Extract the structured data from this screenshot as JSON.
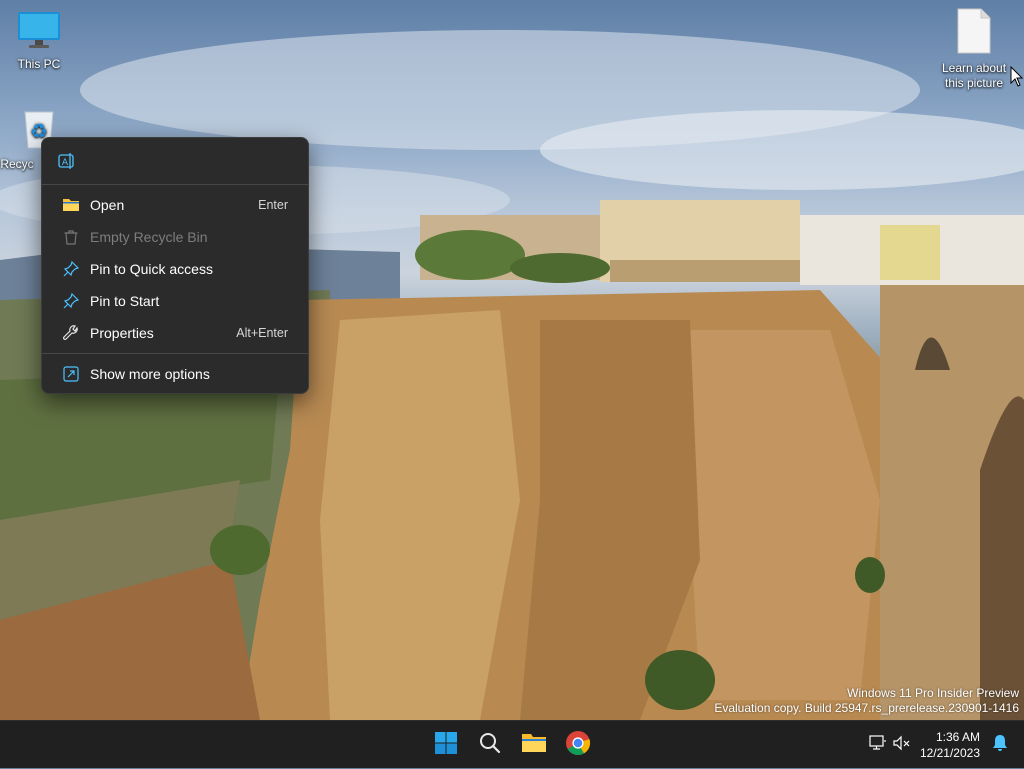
{
  "desktop": {
    "icons": [
      {
        "label": "This PC",
        "icon": "monitor-icon"
      },
      {
        "label": "Recycle Bin",
        "visible_label": "Recyc",
        "icon": "recycle-bin-icon"
      },
      {
        "label_line1": "Learn about",
        "label_line2": "this picture",
        "icon": "document-icon"
      }
    ]
  },
  "context_menu": {
    "top_action_icon": "rename-icon",
    "items": [
      {
        "label": "Open",
        "shortcut": "Enter",
        "icon": "folder-icon",
        "enabled": true
      },
      {
        "label": "Empty Recycle Bin",
        "shortcut": "",
        "icon": "trash-icon",
        "enabled": false
      },
      {
        "label": "Pin to Quick access",
        "shortcut": "",
        "icon": "pin-icon",
        "enabled": true
      },
      {
        "label": "Pin to Start",
        "shortcut": "",
        "icon": "pin-icon",
        "enabled": true
      },
      {
        "label": "Properties",
        "shortcut": "Alt+Enter",
        "icon": "wrench-icon",
        "enabled": true
      },
      {
        "label": "Show more options",
        "shortcut": "",
        "icon": "more-options-icon",
        "enabled": true
      }
    ]
  },
  "watermark": {
    "line1": "Windows 11 Pro Insider Preview",
    "line2": "Evaluation copy. Build 25947.rs_prerelease.230901-1416"
  },
  "taskbar": {
    "apps": [
      "start-icon",
      "search-icon",
      "file-explorer-icon",
      "chrome-icon"
    ],
    "time": "1:36 AM",
    "date": "12/21/2023"
  },
  "colors": {
    "menu_bg": "#2b2b2b",
    "taskbar_bg": "#202020",
    "accent": "#4cc2ff"
  }
}
